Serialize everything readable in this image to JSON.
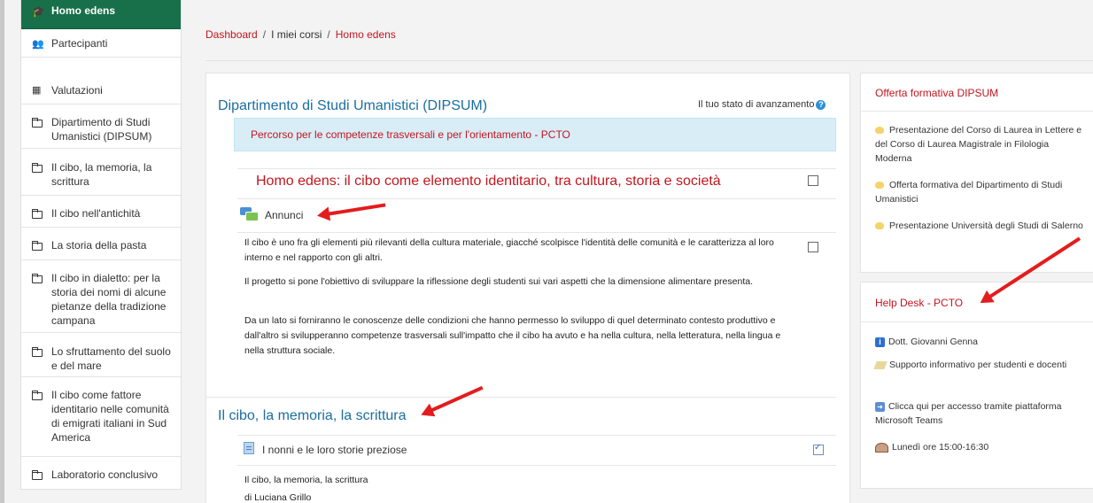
{
  "sidebar": {
    "items": [
      {
        "label": "Homo edens",
        "icon": "graduation-cap-icon"
      },
      {
        "label": "Partecipanti",
        "icon": "users-icon"
      },
      {
        "label": "Valutazioni",
        "icon": "table-icon"
      },
      {
        "label": "Dipartimento di Studi Umanistici (DIPSUM)",
        "icon": "folder-icon"
      },
      {
        "label": "Il cibo, la memoria, la scrittura",
        "icon": "folder-icon"
      },
      {
        "label": "Il cibo nell'antichità",
        "icon": "folder-icon"
      },
      {
        "label": "La storia della pasta",
        "icon": "folder-icon"
      },
      {
        "label": "Il cibo in dialetto: per la storia dei nomi di alcune pietanze della tradizione campana",
        "icon": "folder-icon"
      },
      {
        "label": "Lo sfruttamento del suolo e del mare",
        "icon": "folder-icon"
      },
      {
        "label": "Il cibo come fattore identitario nelle comunità di emigrati italiani in Sud America",
        "icon": "folder-icon"
      },
      {
        "label": "Laboratorio conclusivo",
        "icon": "folder-icon"
      }
    ]
  },
  "breadcrumb": {
    "dashboard": "Dashboard",
    "courses": "I miei corsi",
    "current": "Homo edens",
    "separator": "/"
  },
  "main": {
    "section1_title": "Dipartimento di Studi Umanistici (DIPSUM)",
    "progress_label": "Il tuo stato di avanzamento",
    "progress_help": "?",
    "alert": "Percorso per le competenze trasversali e per l'orientamento - PCTO",
    "topic_title": "Homo edens: il cibo come elemento identitario, tra cultura, storia e società",
    "announcements": "Annunci",
    "paragraphs": [
      "Il cibo è uno fra gli elementi più rilevanti della cultura materiale, giacché scolpisce l'identità delle comunità e le caratterizza al loro interno e nel rapporto con gli altri.",
      "Il progetto si pone l'obiettivo di sviluppare la riflessione degli studenti sui vari aspetti che la dimensione alimentare presenta.",
      "Da un lato si forniranno le conoscenze delle condizioni che hanno permesso lo sviluppo di quel determinato contesto produttivo e dall'altro si svilupperanno competenze trasversali sull'impatto che il cibo ha avuto e ha nella cultura, nella letteratura, nella lingua e nella struttura sociale."
    ],
    "section2_title": "Il cibo, la memoria, la scrittura",
    "resource_title": "I nonni e le loro storie preziose",
    "resource_sub1": "Il cibo, la memoria, la scrittura",
    "resource_sub2": "di Luciana Grillo"
  },
  "blocks": {
    "offerta": {
      "title": "Offerta formativa DIPSUM",
      "links": [
        "Presentazione del Corso di Laurea in Lettere e del Corso di Laurea Magistrale in Filologia Moderna",
        "Offerta formativa del Dipartimento di Studi Umanistici",
        "Presentazione Università degli Studi di Salerno"
      ]
    },
    "helpdesk": {
      "title": "Help Desk - PCTO",
      "contact": "Dott. Giovanni Genna",
      "support": "Supporto informativo per studenti e docenti",
      "teams": "Clicca qui per accesso tramite piattaforma Microsoft Teams",
      "hours": "Lunedì ore 15:00-16:30"
    }
  },
  "colors": {
    "active_nav": "#17704a",
    "link_red": "#c2161e",
    "section_blue": "#1a6ea0",
    "alert_bg": "#d9edf7",
    "arrow_red": "#e31d1d"
  }
}
